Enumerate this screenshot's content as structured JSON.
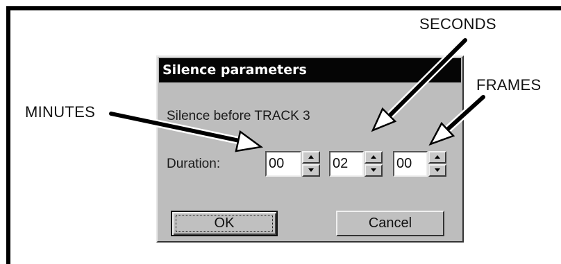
{
  "callouts": {
    "seconds": "SECONDS",
    "frames": "FRAMES",
    "minutes": "MINUTES"
  },
  "dialog": {
    "title": "Silence parameters",
    "message": "Silence before TRACK 3",
    "duration_label": "Duration:",
    "minutes_value": "00",
    "seconds_value": "02",
    "frames_value": "00",
    "ok_label": "OK",
    "cancel_label": "Cancel"
  },
  "icons": {
    "spin_up": "triangle-up-icon",
    "spin_down": "triangle-down-icon"
  },
  "colors": {
    "dialog_face": "#bdbdbd",
    "title_bar": "#050505",
    "title_text": "#ffffff",
    "arrow": "#000000",
    "arrow_outline": "#ffffff"
  }
}
